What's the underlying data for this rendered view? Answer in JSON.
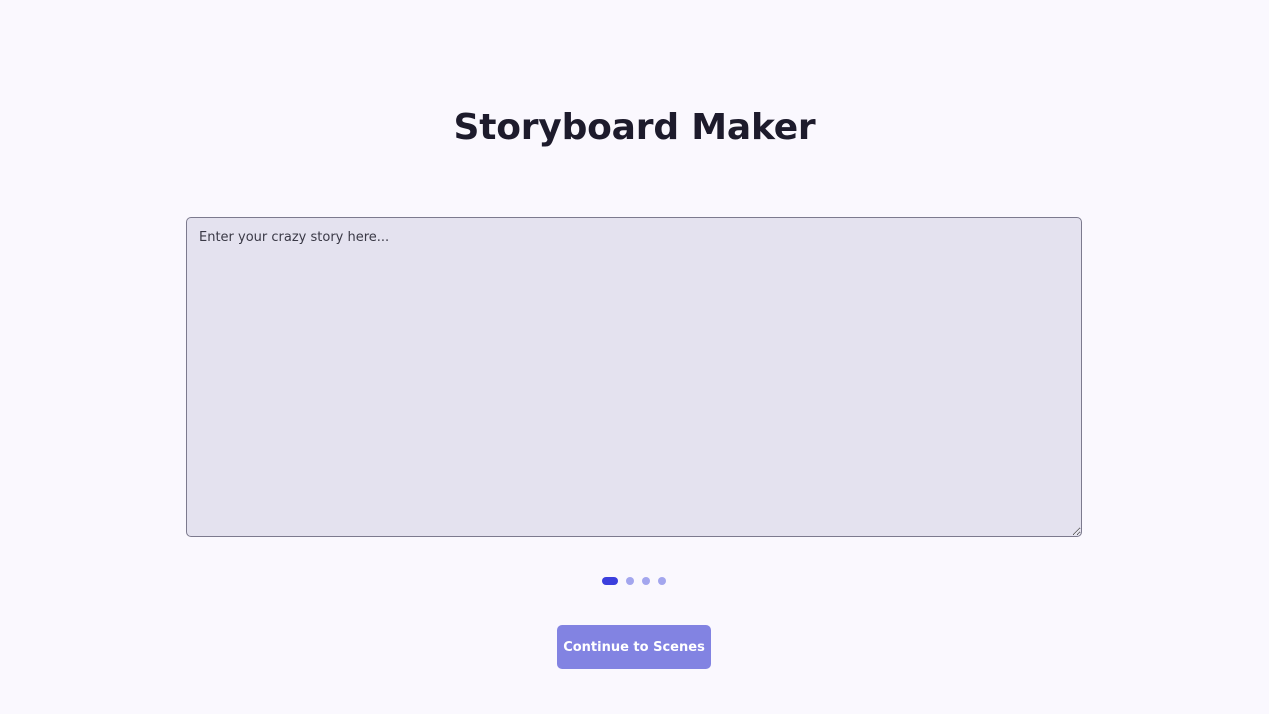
{
  "app": {
    "title": "Storyboard Maker"
  },
  "story_input": {
    "value": "",
    "placeholder": "Enter your crazy story here..."
  },
  "stepper": {
    "total_steps": 4,
    "current_step": 1
  },
  "actions": {
    "continue_label": "Continue to Scenes"
  },
  "colors": {
    "background": "#faf8fe",
    "accent": "#3b3fdd",
    "accent_inactive": "#a3a6ee",
    "button": "#8283e2"
  }
}
